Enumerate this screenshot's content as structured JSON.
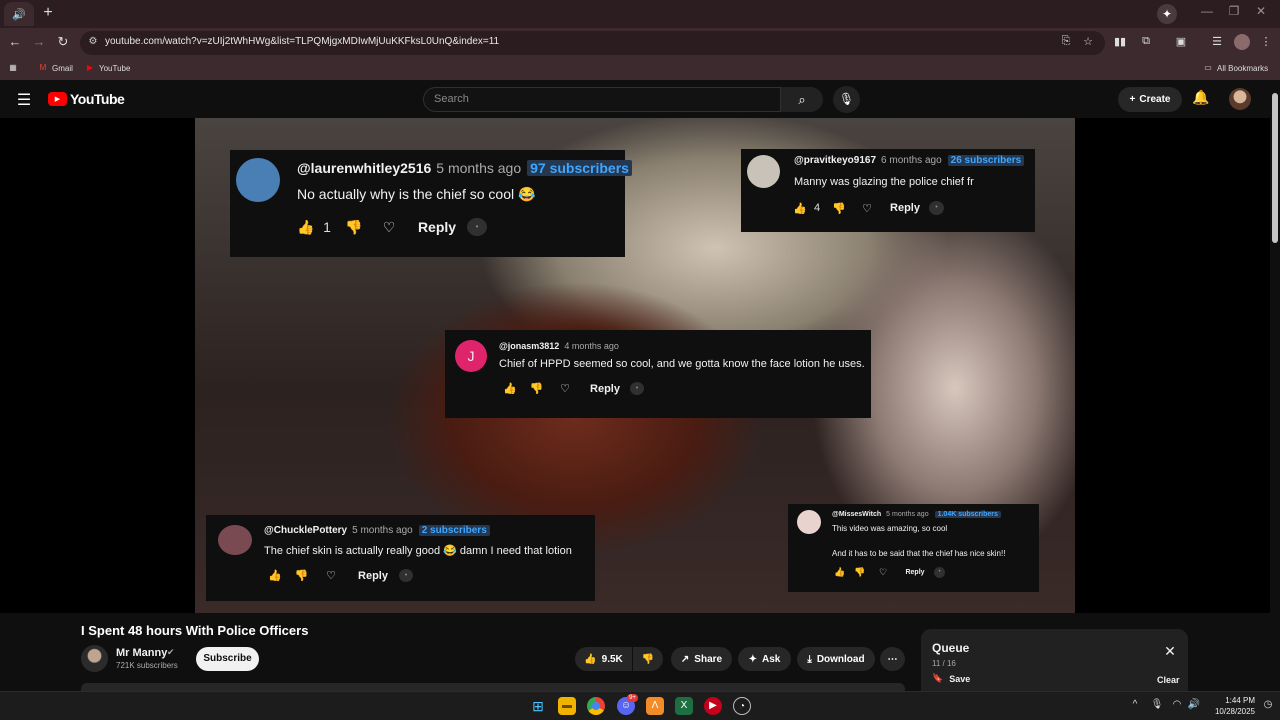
{
  "browser": {
    "tab_icon": "speaker-icon",
    "url": "youtube.com/watch?v=zUIj2tWhHWg&list=TLPQMjgxMDIwMjUuKKFksL0UnQ&index=11",
    "bookmarks": [
      {
        "label": "Gmail",
        "icon": "gmail-icon"
      },
      {
        "label": "YouTube",
        "icon": "youtube-icon"
      }
    ],
    "all_bookmarks": "All Bookmarks"
  },
  "masthead": {
    "logo_text": "YouTube",
    "search_placeholder": "Search",
    "create_label": "Create"
  },
  "comments": [
    {
      "handle": "@laurenwhitley2516",
      "time": "5 months ago",
      "subs": "97 subscribers",
      "text": "No actually why is the chief so cool 😂",
      "likes": "1",
      "reply": "Reply",
      "avatar_color": "#4a7fb5"
    },
    {
      "handle": "@pravitkeyo9167",
      "time": "6 months ago",
      "subs": "26 subscribers",
      "text": "Manny was glazing the police chief fr",
      "likes": "4",
      "reply": "Reply",
      "avatar_color": "#c9c2b8"
    },
    {
      "handle": "@jonasm3812",
      "time": "4 months ago",
      "subs": "",
      "text": "Chief of HPPD seemed so cool, and we gotta know the face lotion he uses.",
      "likes": "",
      "reply": "Reply",
      "avatar_letter": "J",
      "avatar_color": "#e0246c"
    },
    {
      "handle": "@ChucklePottery",
      "time": "5 months ago",
      "subs": "2 subscribers",
      "text": "The chief skin is actually really good 😂 damn I need that lotion",
      "likes": "",
      "reply": "Reply",
      "avatar_color": "#7a4a52"
    },
    {
      "handle": "@MissesWitch",
      "time": "5 months ago",
      "subs": "1.04K subscribers",
      "text": "This video was amazing, so cool",
      "text2": "And it has to be said that the chief has nice skin!!",
      "likes": "",
      "reply": "Reply",
      "avatar_color": "#e9d3cf"
    }
  ],
  "video": {
    "title": "I Spent 48 hours With Police Officers",
    "channel": "Mr Manny",
    "subscribers": "721K subscribers",
    "subscribe_label": "Subscribe",
    "likes": "9.5K",
    "share_label": "Share",
    "ask_label": "Ask",
    "download_label": "Download"
  },
  "queue": {
    "title": "Queue",
    "count": "11 / 16",
    "save_label": "Save",
    "clear_label": "Clear"
  },
  "taskbar": {
    "time": "1:44 PM",
    "date": "10/28/2025",
    "discord_badge": "9+"
  },
  "colors": {
    "chrome_bg": "#3c2a2e",
    "yt_red": "#ff0000",
    "subs_badge": "#3ea6ff"
  }
}
